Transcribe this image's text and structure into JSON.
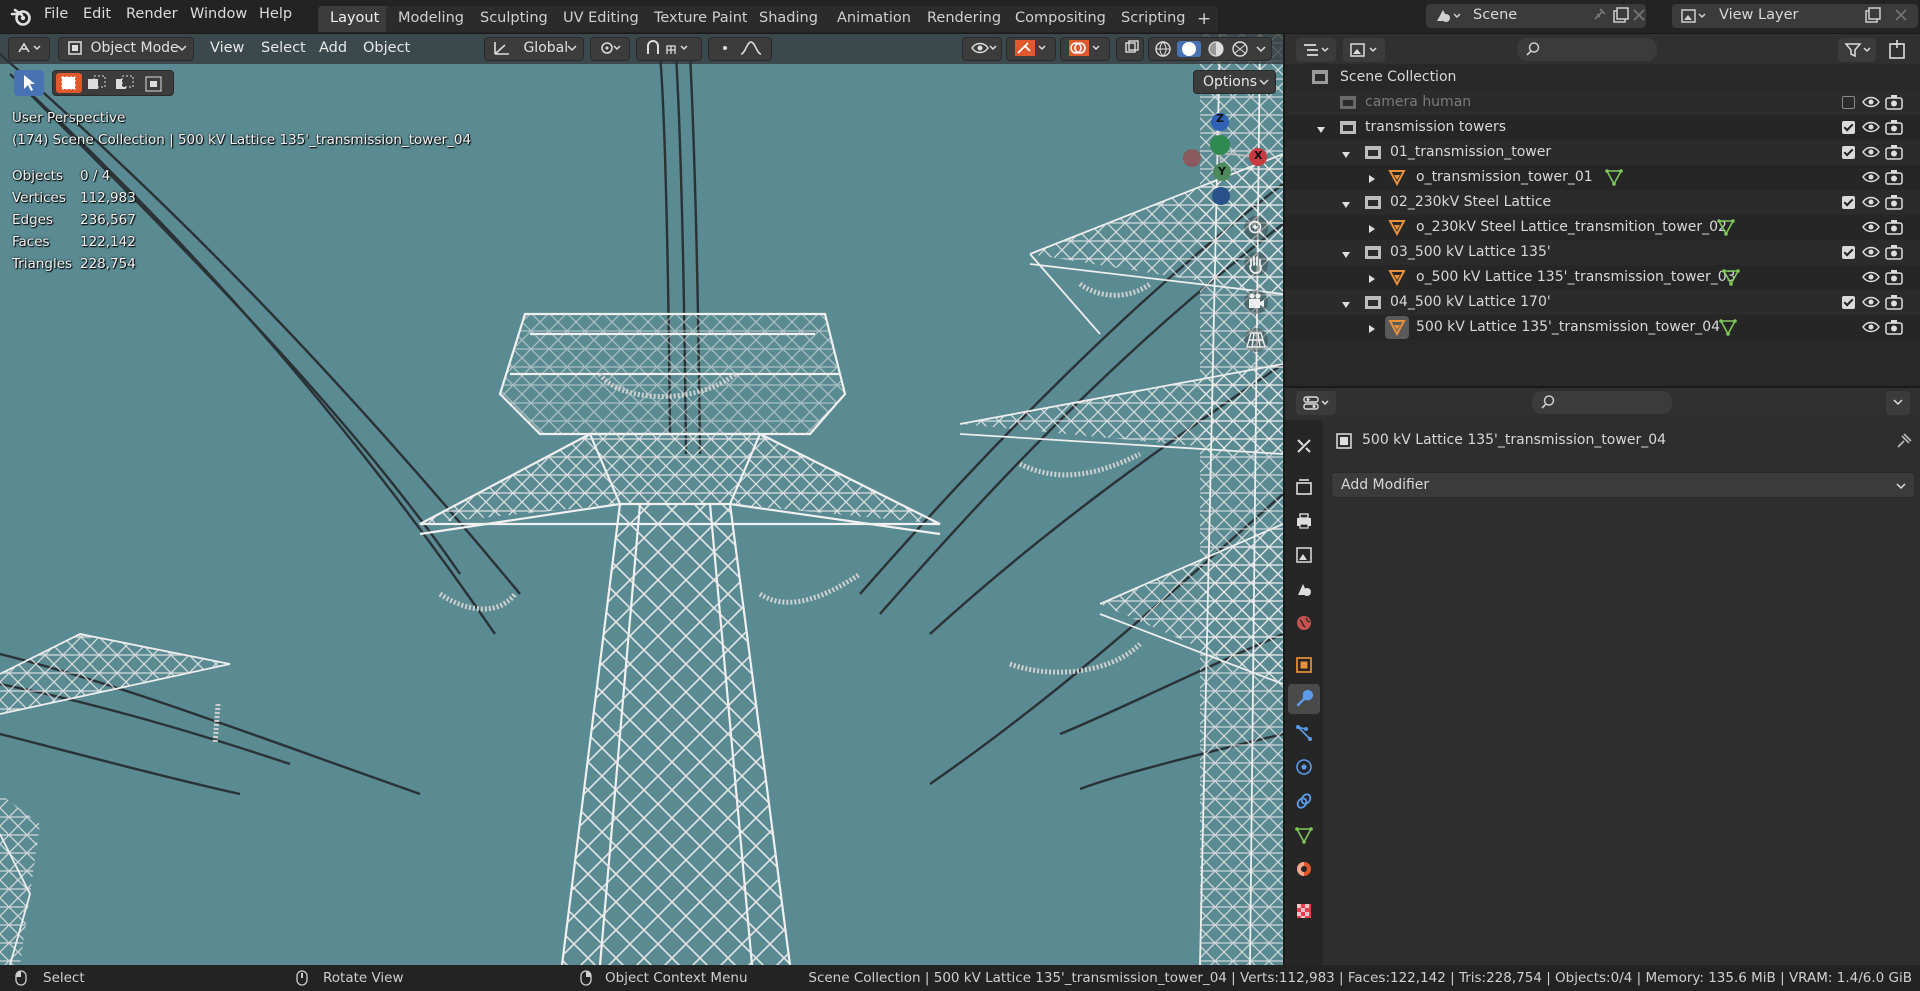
{
  "topbar": {
    "menus": [
      "File",
      "Edit",
      "Render",
      "Window",
      "Help"
    ],
    "workspaces": [
      "Layout",
      "Modeling",
      "Sculpting",
      "UV Editing",
      "Texture Paint",
      "Shading",
      "Animation",
      "Rendering",
      "Compositing",
      "Scripting"
    ],
    "active_workspace": "Layout",
    "add_tab": "+",
    "scene": "Scene",
    "view_layer": "View Layer"
  },
  "viewport": {
    "mode": "Object Mode",
    "menus": [
      "View",
      "Select",
      "Add",
      "Object"
    ],
    "orientation": "Global",
    "options": "Options",
    "perspective": "User Perspective",
    "object_info": "(174) Scene Collection | 500 kV Lattice 135'_transmission_tower_04",
    "stats": [
      {
        "label": "Objects",
        "value": "0 / 4"
      },
      {
        "label": "Vertices",
        "value": "112,983"
      },
      {
        "label": "Edges",
        "value": "236,567"
      },
      {
        "label": "Faces",
        "value": "122,142"
      },
      {
        "label": "Triangles",
        "value": "228,754"
      }
    ],
    "gizmo": {
      "z": "Z",
      "x": "X",
      "y": "Y"
    },
    "background_color": "#5a8a92"
  },
  "outliner": {
    "root": "Scene Collection",
    "rows": [
      {
        "label": "camera human",
        "level": 1,
        "type": "collection",
        "disabled": true,
        "checked": false
      },
      {
        "label": "transmission towers",
        "level": 1,
        "type": "collection",
        "checked": true
      },
      {
        "label": "01_transmission_tower",
        "level": 2,
        "type": "collection",
        "checked": true
      },
      {
        "label": "o_transmission_tower_01",
        "level": 3,
        "type": "object"
      },
      {
        "label": "02_230kV Steel Lattice",
        "level": 2,
        "type": "collection",
        "checked": true
      },
      {
        "label": "o_230kV Steel Lattice_transmition_tower_02",
        "level": 3,
        "type": "object"
      },
      {
        "label": "03_500 kV Lattice 135'",
        "level": 2,
        "type": "collection",
        "checked": true
      },
      {
        "label": "o_500 kV Lattice 135'_transmission_tower_03",
        "level": 3,
        "type": "object"
      },
      {
        "label": "04_500 kV Lattice 170'",
        "level": 2,
        "type": "collection",
        "checked": true
      },
      {
        "label": "500 kV Lattice 135'_transmission_tower_04",
        "level": 3,
        "type": "object",
        "active": true
      }
    ]
  },
  "properties": {
    "object_name": "500 kV Lattice 135'_transmission_tower_04",
    "add_modifier": "Add Modifier",
    "active_tab": "modifier-tab"
  },
  "status": {
    "select": "Select",
    "rotate": "Rotate View",
    "context": "Object Context Menu",
    "info": "Scene Collection | 500 kV Lattice 135'_transmission_tower_04 | Verts:112,983 | Faces:122,142 | Tris:228,754 | Objects:0/4 | Memory: 135.6 MiB | VRAM: 1.4/6.0 GiB"
  },
  "colors": {
    "accent": "#4772b3",
    "active_tab_orange": "#e0582c",
    "panel": "#2e2e2e",
    "header": "#232323"
  }
}
